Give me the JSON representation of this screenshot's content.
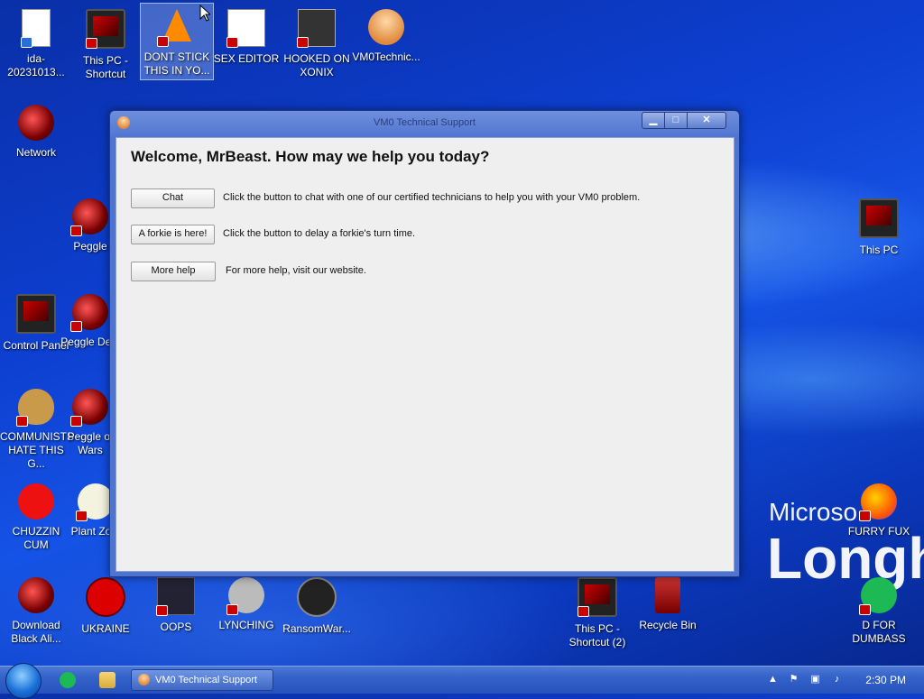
{
  "desktop": {
    "brand": {
      "line1": "Microso",
      "line2": "Longh"
    },
    "icons": [
      {
        "label": "ida-20231013..."
      },
      {
        "label": "This PC - Shortcut"
      },
      {
        "label": "DONT STICK THIS IN YO..."
      },
      {
        "label": "SEX EDITOR"
      },
      {
        "label": "HOOKED ON XONIX"
      },
      {
        "label": "VM0Technic..."
      },
      {
        "label": "Network"
      },
      {
        "label": "Peggle"
      },
      {
        "label": "Control Panel"
      },
      {
        "label": "Peggle Delu"
      },
      {
        "label": "COMMUNISTS HATE THIS G..."
      },
      {
        "label": "Peggle of Wars"
      },
      {
        "label": "CHUZZIN CUM"
      },
      {
        "label": "Plant Zom"
      },
      {
        "label": "Download Black Ali..."
      },
      {
        "label": "UKRAINE"
      },
      {
        "label": "OOPS"
      },
      {
        "label": "LYNCHING"
      },
      {
        "label": "RansomWar..."
      },
      {
        "label": "This PC - Shortcut (2)"
      },
      {
        "label": "Recycle Bin"
      },
      {
        "label": "This PC"
      },
      {
        "label": "FURRY FUX"
      },
      {
        "label": "D FOR DUMBASS"
      }
    ]
  },
  "window": {
    "title": "VM0 Technical Support",
    "welcome": "Welcome, MrBeast. How may we help you today?",
    "rows": [
      {
        "button": "Chat",
        "text": "Click the button to chat with one of our certified technicians to help you with your VM0 problem."
      },
      {
        "button": "A forkie is here!",
        "text": "Click the button to delay a forkie's turn time."
      },
      {
        "button": "More help",
        "text": "For more help, visit our website."
      }
    ]
  },
  "taskbar": {
    "task_title": "VM0 Technical Support",
    "clock": "2:30 PM"
  }
}
